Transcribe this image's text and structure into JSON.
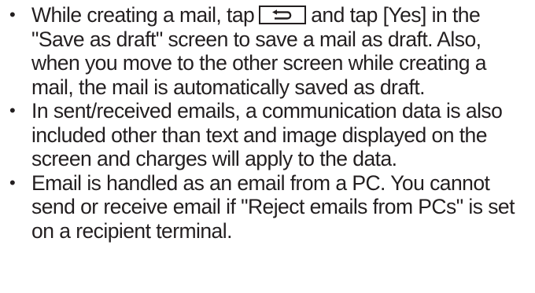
{
  "bullet_glyph": "•",
  "icons": {
    "back_key": "back-arrow-icon"
  },
  "notes": [
    {
      "lines": [
        {
          "before_icon": "While creating a mail, tap",
          "after_icon": "and tap [Yes] in the"
        },
        "\"Save as draft\" screen to save a mail as draft. Also,",
        "when you move to the other screen while creating a",
        "mail, the mail is automatically saved as draft."
      ]
    },
    {
      "lines": [
        "In sent/received emails, a communication data is also",
        "included other than text and image displayed on the",
        "screen and charges will apply to the data."
      ]
    },
    {
      "lines": [
        "Email is handled as an email from a PC. You cannot",
        "send or receive email if \"Reject emails from PCs\" is set",
        "on a recipient terminal."
      ]
    }
  ]
}
